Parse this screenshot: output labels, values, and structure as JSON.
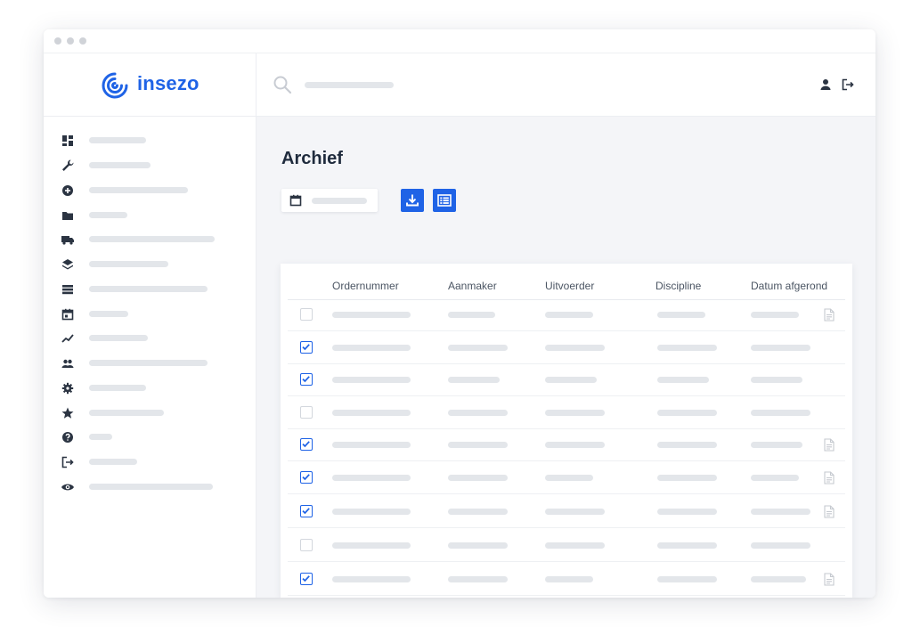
{
  "app": {
    "brand": "insezo"
  },
  "colors": {
    "accent": "#1f63e6",
    "icon": "#2b3442",
    "placeholder": "#e3e6ea",
    "background": "#f4f5f8"
  },
  "sidebar": {
    "items": [
      {
        "icon": "dashboard-icon"
      },
      {
        "icon": "wrench-icon"
      },
      {
        "icon": "add-circle-icon"
      },
      {
        "icon": "folder-icon"
      },
      {
        "icon": "truck-icon"
      },
      {
        "icon": "layers-icon"
      },
      {
        "icon": "list-icon"
      },
      {
        "icon": "calendar-icon"
      },
      {
        "icon": "trend-icon"
      },
      {
        "icon": "people-icon"
      },
      {
        "icon": "gear-icon"
      },
      {
        "icon": "star-icon"
      },
      {
        "icon": "help-icon"
      },
      {
        "icon": "logout-icon"
      },
      {
        "icon": "eye-icon"
      }
    ]
  },
  "topbar": {
    "search_icon": "search-icon",
    "user_icon": "user-icon",
    "logout_icon": "logout-icon"
  },
  "page": {
    "title": "Archief"
  },
  "toolbar": {
    "date_icon": "calendar-icon",
    "download_icon": "download-icon",
    "list_view_icon": "list-view-icon"
  },
  "table": {
    "columns": [
      "Ordernummer",
      "Aanmaker",
      "Uitvoerder",
      "Discipline",
      "Datum afgerond"
    ],
    "rows": [
      {
        "checked": false,
        "has_document": true
      },
      {
        "checked": true,
        "has_document": false
      },
      {
        "checked": true,
        "has_document": false
      },
      {
        "checked": false,
        "has_document": false
      },
      {
        "checked": true,
        "has_document": true
      },
      {
        "checked": true,
        "has_document": true
      },
      {
        "checked": true,
        "has_document": true
      },
      {
        "checked": false,
        "has_document": false
      },
      {
        "checked": true,
        "has_document": true
      },
      {
        "checked": true,
        "has_document": true
      }
    ]
  }
}
